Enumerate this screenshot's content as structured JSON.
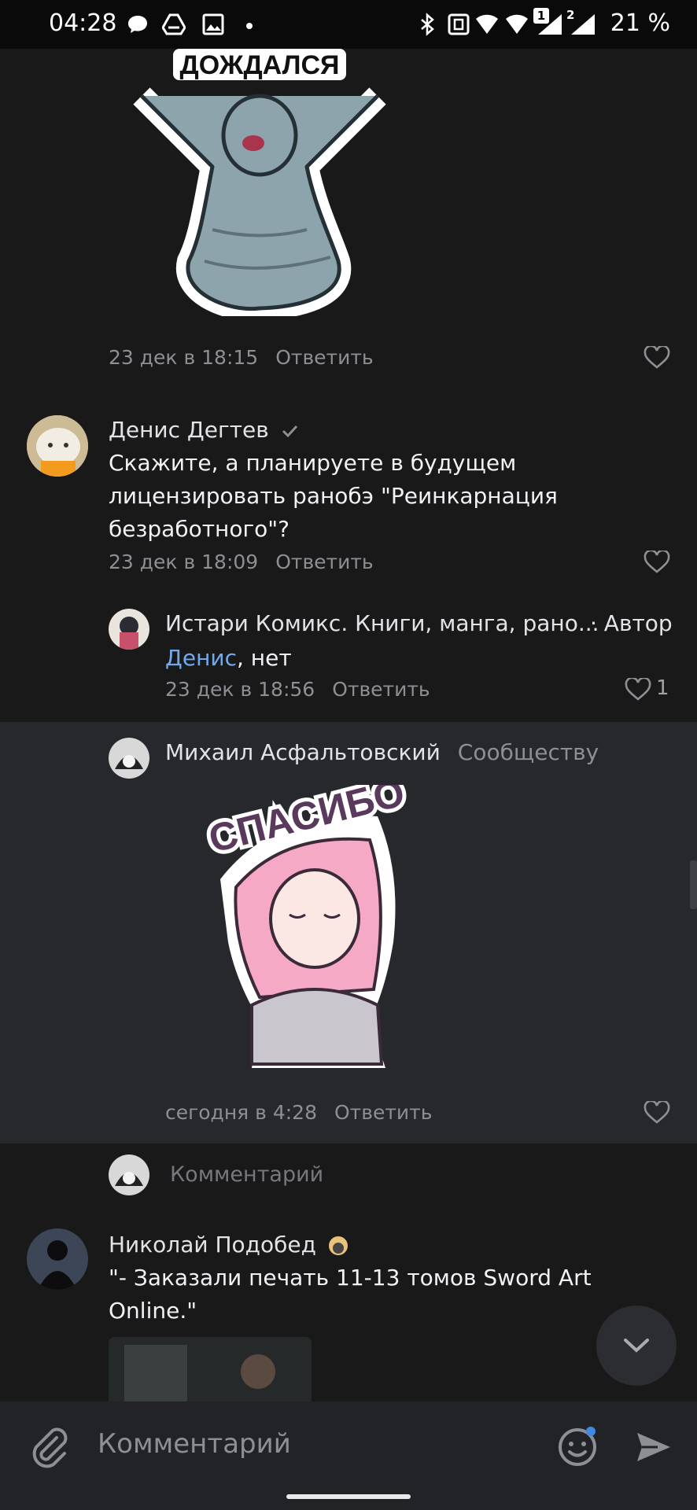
{
  "status_bar": {
    "time": "04:28",
    "battery": "21 %",
    "sim1": "1",
    "sim2": "2"
  },
  "sticker1": {
    "caption": "ДОЖДАЛСЯ"
  },
  "comment1": {
    "date": "23 дек в 18:15",
    "reply": "Ответить"
  },
  "comment2": {
    "author": "Денис Дегтев",
    "text": "Скажите, а планируете в будущем лицензировать ранобэ \"Реинкарнация безработного\"?",
    "date": "23 дек в 18:09",
    "reply": "Ответить"
  },
  "reply1": {
    "author": "Истари Комикс. Книги, манга, рано...",
    "badge": "· Автор",
    "mention": "Денис",
    "text": ", нет",
    "date": "23 дек в 18:56",
    "reply": "Ответить",
    "likes": "1"
  },
  "reply2": {
    "author": "Михаил Асфальтовский",
    "target": "Сообществу",
    "sticker_caption": "СПАСИБО",
    "date": "сегодня в 4:28",
    "reply": "Ответить"
  },
  "reply_input": {
    "placeholder": "Комментарий"
  },
  "comment3": {
    "author": "Николай Подобед",
    "text": "\"- Заказали печать 11-13 томов Sword Art Online.\""
  },
  "composer": {
    "placeholder": "Комментарий"
  },
  "colors": {
    "background": "#19191a",
    "highlight": "#26282c",
    "accent": "#71aaeb",
    "meta": "#8d8f94"
  },
  "icons": [
    "message-icon",
    "drive-icon",
    "gallery-icon",
    "bluetooth-icon",
    "nfc-icon",
    "wifi-icon",
    "signal-icon",
    "heart-icon",
    "verified-icon",
    "paperclip-icon",
    "emoji-icon",
    "send-icon",
    "chevron-down-icon"
  ]
}
